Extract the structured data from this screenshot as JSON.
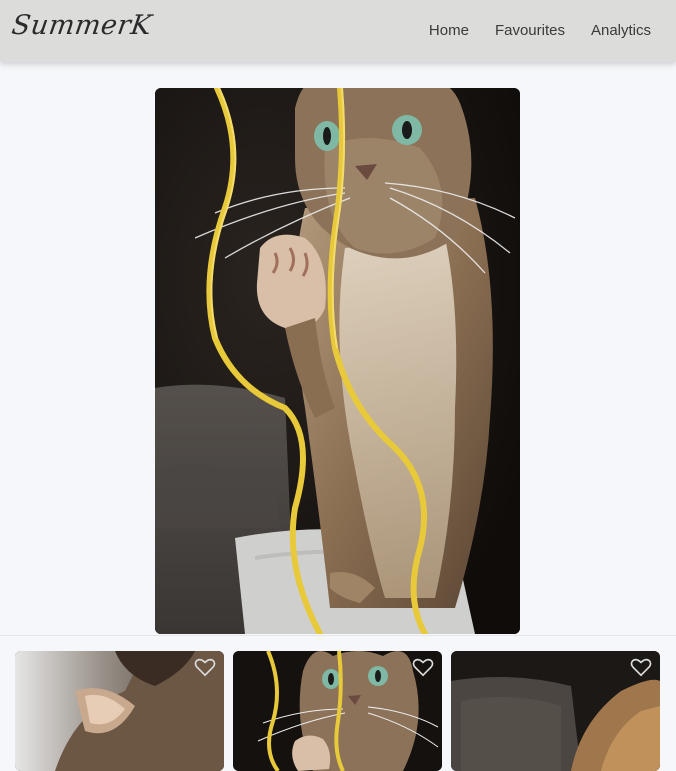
{
  "navbar": {
    "brand": "SummerK",
    "links": [
      "Home",
      "Favourites",
      "Analytics"
    ]
  },
  "hero": {
    "image": "cat-with-yellow-ribbon"
  },
  "thumbnails": [
    {
      "image": "cat-ear-closeup",
      "icon": "heart-outline-icon"
    },
    {
      "image": "cat-with-yellow-ribbon",
      "icon": "heart-outline-icon"
    },
    {
      "image": "cat-on-sofa",
      "icon": "heart-outline-icon"
    }
  ],
  "colors": {
    "navbar_bg": "#dcdddb",
    "page_bg": "#f6f7fa",
    "ribbon": "#e8c93a",
    "eye": "#7fb8a4"
  }
}
